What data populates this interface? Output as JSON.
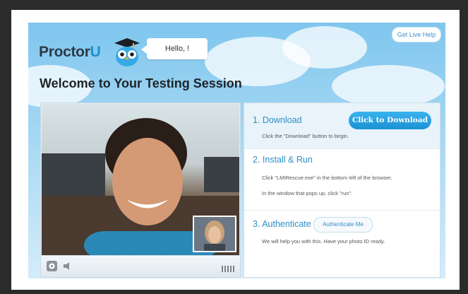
{
  "header": {
    "help_label": "Get Live Help",
    "logo_text": "Proctor",
    "logo_u": "U",
    "greeting": "Hello, !",
    "title": "Welcome to Your Testing Session"
  },
  "video": {
    "settings_icon": "gear-icon",
    "volume_icon": "speaker-icon",
    "signal_icon": "signal-bars-icon"
  },
  "steps": [
    {
      "heading": "1. Download",
      "button": "Click to Download",
      "text": "Click the \"Download\" button to begin."
    },
    {
      "heading": "2. Install & Run",
      "text1": "Click \"LMIRescue.exe\" in the bottom left of the browser.",
      "text2": "In the window that pops up, click \"run\"."
    },
    {
      "heading": "3. Authenticate",
      "button": "Authenticate Me",
      "text": "We will help you with this. Have your photo ID ready."
    }
  ],
  "colors": {
    "accent": "#1c8fd3",
    "sky": "#7fc6ee",
    "button": "#2a9fe0"
  }
}
